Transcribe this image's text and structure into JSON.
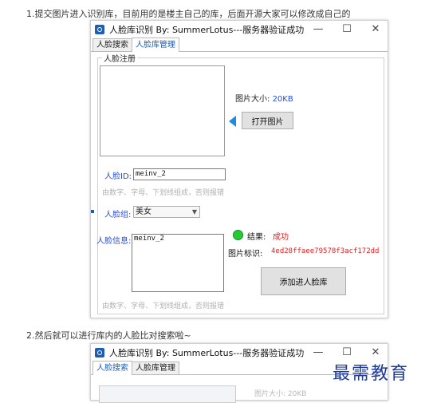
{
  "doc": {
    "step1": "1.提交图片进入识别库，目前用的是楼主自己的库，后面开源大家可以修改成自己的",
    "step2": "2.然后就可以进行库内的人脸比对搜索啦~",
    "watermark": "最需教育"
  },
  "window1": {
    "title": "人脸库识别 By: SummerLotus---服务器验证成功",
    "controls": {
      "minimize": "—",
      "maximize": "☐",
      "close": "✕"
    },
    "tabs": [
      {
        "label": "人脸搜索",
        "active": false
      },
      {
        "label": "人脸库管理",
        "active": true
      }
    ],
    "group_title": "人脸注册",
    "image_size_label": "图片大小:",
    "image_size_value": "20KB",
    "open_image_button": "打开图片",
    "face_id_label": "人脸ID:",
    "face_id_value": "meinv_2",
    "face_id_hint": "由数字、字母、下划线组成，否则报错",
    "face_group_label": "人脸组:",
    "face_group_value": "美女",
    "face_info_label": "人脸信息:",
    "face_info_value": "meinv_2",
    "face_info_hint": "由数字、字母、下划线组成，否则报错",
    "result_label": "结果:",
    "result_value": "成功",
    "image_id_label": "图片标识:",
    "image_id_value": "4ed28ffaee79578f3acf172dd8",
    "add_button": "添加进人脸库",
    "status_color": "#22cc33",
    "accent_color": "#2a4fd0",
    "error_color": "#e02020"
  },
  "window2": {
    "title": "人脸库识别 By: SummerLotus---服务器验证成功",
    "controls": {
      "minimize": "—",
      "maximize": "☐",
      "close": "✕"
    },
    "tabs": [
      {
        "label": "人脸搜索",
        "active": true
      },
      {
        "label": "人脸库管理",
        "active": false
      }
    ],
    "partial_label": "图片大小: 20KB"
  }
}
